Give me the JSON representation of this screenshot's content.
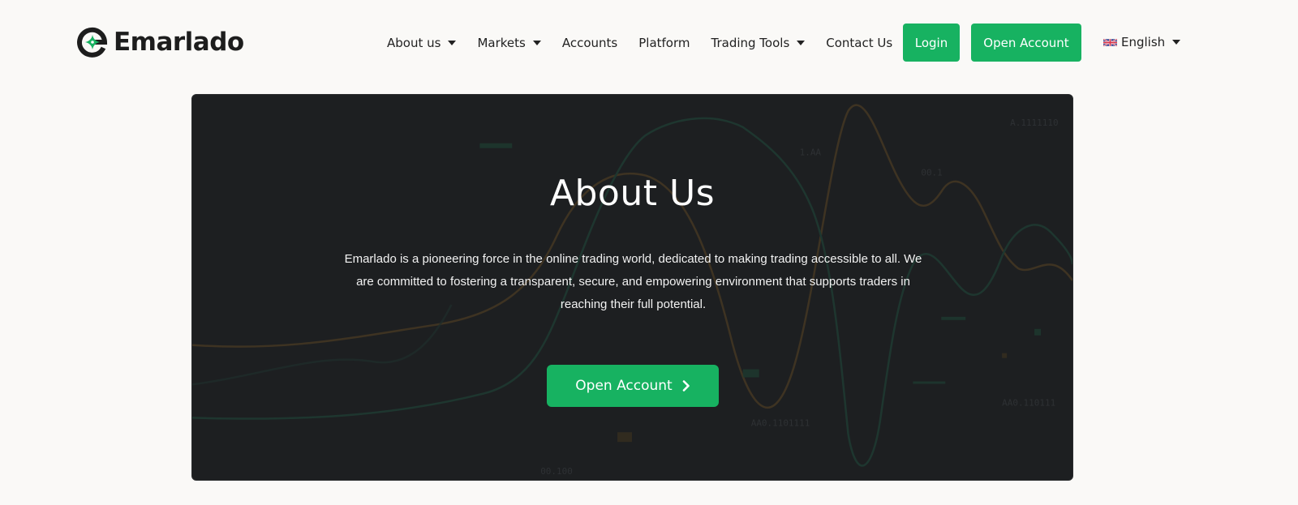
{
  "brand": {
    "name": "Emarlado",
    "accent_color": "#17b261",
    "dark_color": "#1d1d1d"
  },
  "nav": {
    "items": [
      {
        "label": "About us",
        "has_dropdown": true
      },
      {
        "label": "Markets",
        "has_dropdown": true
      },
      {
        "label": "Accounts",
        "has_dropdown": false
      },
      {
        "label": "Platform",
        "has_dropdown": false
      },
      {
        "label": "Trading Tools",
        "has_dropdown": true
      },
      {
        "label": "Contact Us",
        "has_dropdown": false
      }
    ],
    "login_label": "Login",
    "open_account_label": "Open Account",
    "language": {
      "label": "English",
      "flag_icon": "uk-flag-icon"
    }
  },
  "hero": {
    "title": "About Us",
    "description": "Emarlado is a pioneering force in the online trading world, dedicated to making trading accessible to all. We are committed to fostering a transparent, secure, and empowering environment that supports traders in reaching their full potential.",
    "cta_label": "Open Account",
    "cta_icon": "chevron-right-icon",
    "background_color": "#1d1f21"
  }
}
